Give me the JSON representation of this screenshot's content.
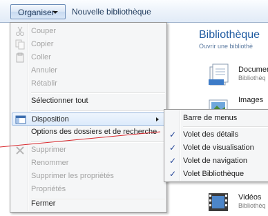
{
  "toolbar": {
    "organiser_label": "Organiser",
    "new_library_label": "Nouvelle bibliothèque"
  },
  "library": {
    "title": "Bibliothèque",
    "subtitle": "Ouvrir une bibliothè",
    "items": [
      {
        "name": "Document",
        "sub": "Bibliothèq",
        "icon": "documents-library-icon"
      },
      {
        "name": "Images",
        "sub": "",
        "icon": "images-library-icon"
      },
      {
        "name": "Vidéos",
        "sub": "Bibliothèq",
        "icon": "videos-library-icon"
      }
    ]
  },
  "menu": {
    "items": [
      {
        "label": "Couper",
        "disabled": true,
        "icon": "scissors-icon"
      },
      {
        "label": "Copier",
        "disabled": true,
        "icon": "copy-icon"
      },
      {
        "label": "Coller",
        "disabled": true,
        "icon": "clipboard-icon"
      },
      {
        "label": "Annuler",
        "disabled": true
      },
      {
        "label": "Rétablir",
        "disabled": true
      },
      {
        "label": "Sélectionner tout",
        "disabled": false
      },
      {
        "label": "Disposition",
        "disabled": false,
        "highlighted": true,
        "submenu": true,
        "icon": "layout-icon"
      },
      {
        "label": "Options des dossiers et de recherche",
        "disabled": false
      },
      {
        "label": "Supprimer",
        "disabled": true,
        "icon": "delete-x-icon"
      },
      {
        "label": "Renommer",
        "disabled": true
      },
      {
        "label": "Supprimer les propriétés",
        "disabled": true
      },
      {
        "label": "Propriétés",
        "disabled": true
      },
      {
        "label": "Fermer",
        "disabled": false
      }
    ]
  },
  "submenu": {
    "items": [
      {
        "label": "Barre de menus",
        "checked": false
      },
      {
        "label": "Volet des détails",
        "checked": true
      },
      {
        "label": "Volet de visualisation",
        "checked": true
      },
      {
        "label": "Volet de navigation",
        "checked": true
      },
      {
        "label": "Volet Bibliothèque",
        "checked": true
      }
    ],
    "check_glyph": "✓"
  },
  "colors": {
    "accent": "#1e5aa0",
    "highlight_border": "#9ebce3",
    "annotation_line": "#d9282d"
  }
}
